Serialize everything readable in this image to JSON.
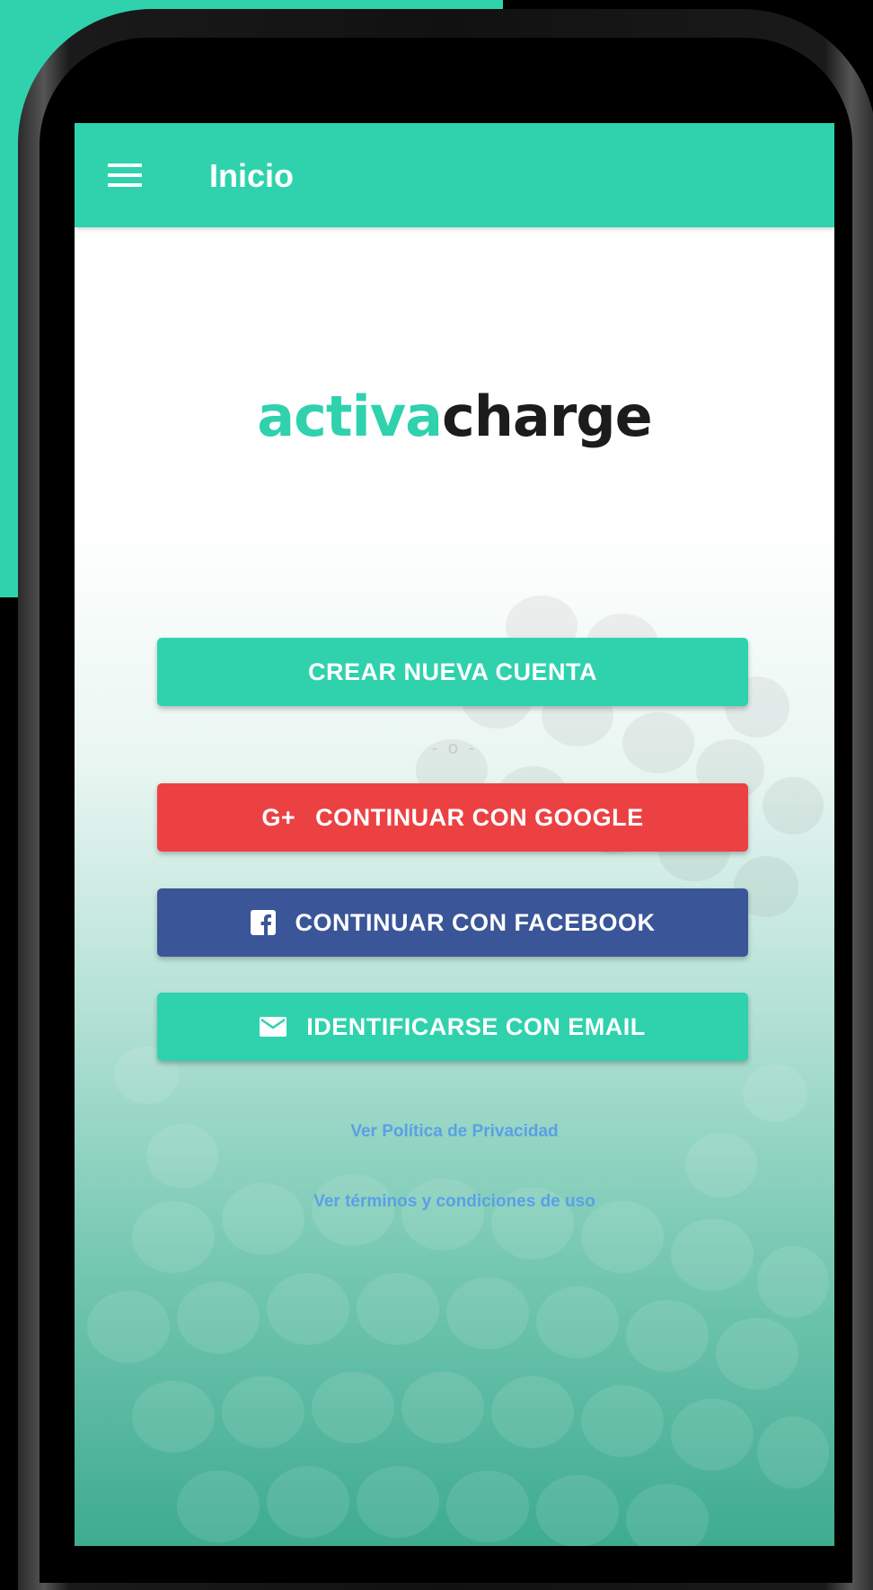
{
  "header": {
    "title": "Inicio",
    "menu_icon": "hamburger-menu-icon"
  },
  "logo": {
    "part1": "activa",
    "part2": "charge"
  },
  "buttons": {
    "create_account": "CREAR NUEVA CUENTA",
    "separator": "- o -",
    "google": "CONTINUAR CON GOOGLE",
    "google_icon": "G+",
    "facebook": "CONTINUAR CON FACEBOOK",
    "facebook_icon": "f",
    "email": "IDENTIFICARSE CON EMAIL",
    "email_icon": "envelope-icon"
  },
  "links": {
    "privacy": "Ver Política de Privacidad",
    "terms": "Ver términos y condiciones de uso"
  },
  "colors": {
    "brand_teal": "#2fd2ad",
    "google_red": "#ec4143",
    "facebook_blue": "#3a5598",
    "link_blue": "#5aa0e6"
  }
}
